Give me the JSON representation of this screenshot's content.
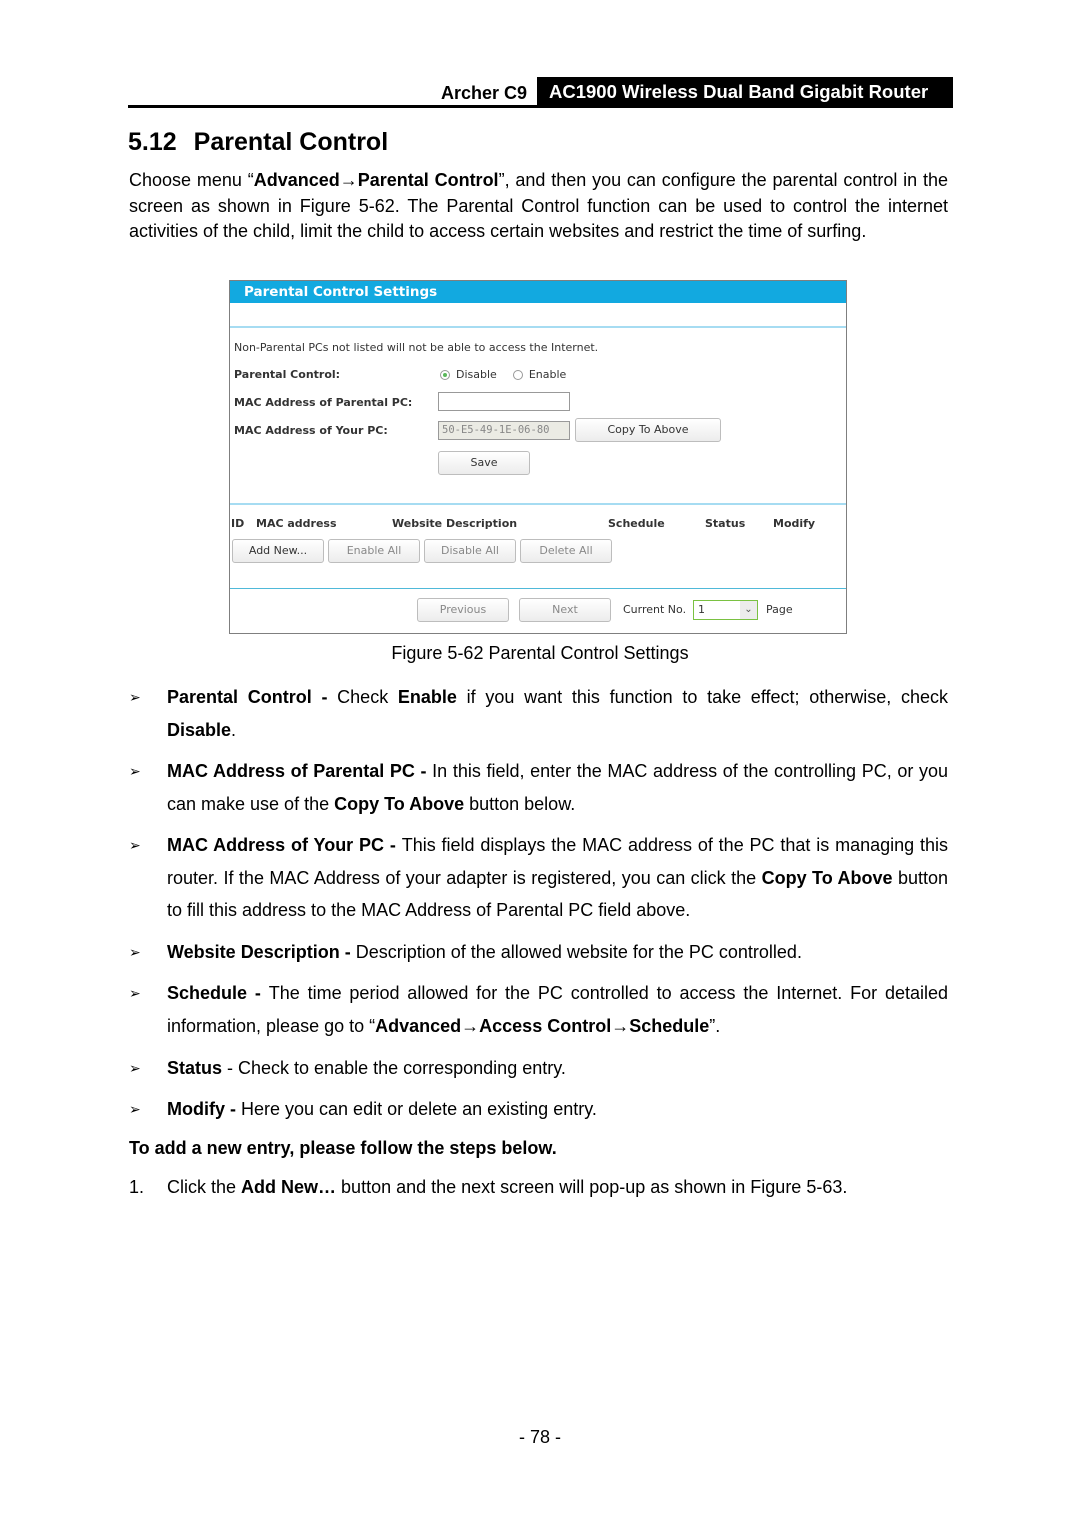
{
  "header": {
    "model": "Archer C9",
    "product": "AC1900 Wireless Dual Band Gigabit Router"
  },
  "section": {
    "number": "5.12",
    "title": "Parental Control"
  },
  "intro": {
    "p1": "Choose menu “",
    "menu_path": "Advanced→Parental Control",
    "p2": "”, and then you can configure the parental control in the screen as shown in Figure 5-62. The Parental Control function can be used to control the internet activities of the child, limit the child to access certain websites and restrict the time of surfing."
  },
  "figure": {
    "panel_title": "Parental Control Settings",
    "note": "Non-Parental PCs not listed will not be able to access the Internet.",
    "parental_control_label": "Parental Control:",
    "radio_disable": "Disable",
    "radio_enable": "Enable",
    "selected": "Disable",
    "mac_parental_label": "MAC Address of Parental PC:",
    "mac_parental_value": "",
    "mac_your_label": "MAC Address of Your PC:",
    "mac_your_value": "50-E5-49-1E-06-80",
    "copy_button": "Copy To Above",
    "save_button": "Save",
    "columns": [
      "ID",
      "MAC address",
      "Website Description",
      "Schedule",
      "Status",
      "Modify"
    ],
    "add_new_button": "Add New...",
    "enable_all_button": "Enable All",
    "disable_all_button": "Disable All",
    "delete_all_button": "Delete All",
    "previous_button": "Previous",
    "next_button": "Next",
    "current_no_label": "Current No.",
    "current_page": "1",
    "page_label": "Page",
    "colors": {
      "title_bar": "#12a9e0",
      "radio_selected": "#5cb85c",
      "select_border": "#7ac142"
    }
  },
  "caption": "Figure 5-62 Parental Control Settings",
  "bullets": [
    {
      "term": "Parental Control",
      "sep": " - ",
      "t1": "Check ",
      "b1": "Enable",
      "t2": " if you want this function to take effect; otherwise, check ",
      "b2": "Disable",
      "t3": "."
    },
    {
      "term": "MAC Address of Parental PC",
      "sep": " - ",
      "t1": "In this field, enter the MAC address of the controlling PC, or you can make use of the ",
      "b1": "Copy To Above",
      "t2": " button below."
    },
    {
      "term": "MAC Address of Your PC",
      "sep": " - ",
      "t1": "This field displays the MAC address of the PC that is managing this router. If the MAC Address of your adapter is registered, you can click the ",
      "b1": "Copy To Above",
      "t2": " button to fill this address to the MAC Address of Parental PC field above."
    },
    {
      "term": "Website Description",
      "sep": " - ",
      "t1": "Description of the allowed website for the PC controlled."
    },
    {
      "term": "Schedule",
      "sep": " - ",
      "t1": "The time period allowed for the PC controlled to access the Internet. For detailed information, please go to “",
      "b1": "Advanced→Access Control→Schedule",
      "t2": "”."
    },
    {
      "term": "Status",
      "sep": " - ",
      "t1": "Check to enable the corresponding entry."
    },
    {
      "term": "Modify",
      "sep": " - ",
      "t1": "Here you can edit or delete an existing entry."
    }
  ],
  "bullet_marker": "➢",
  "steps_heading": "To add a new entry, please follow the steps below.",
  "steps": [
    {
      "n": "1.",
      "t1": "Click the ",
      "b1": "Add New…",
      "t2": " button and the next screen will pop-up as shown in Figure 5-63."
    }
  ],
  "page_number": "- 78 -"
}
